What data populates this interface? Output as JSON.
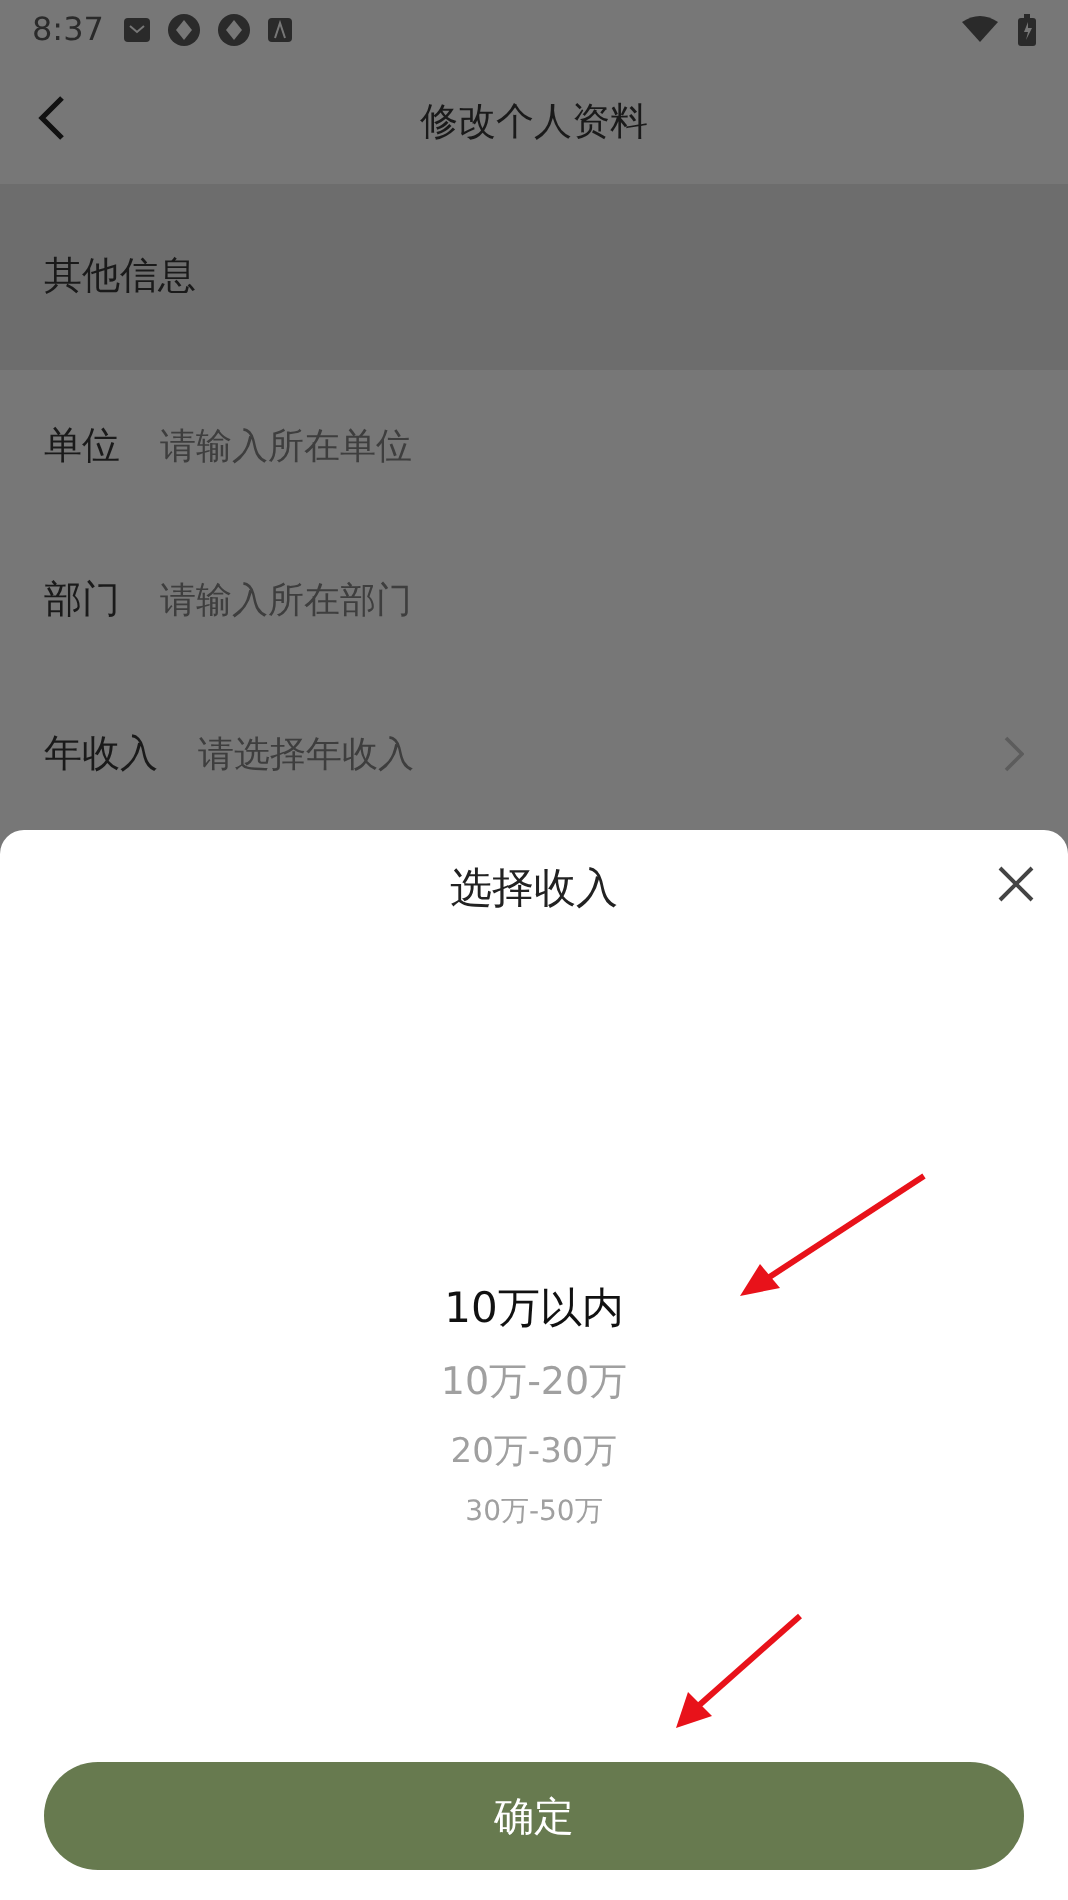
{
  "status_bar": {
    "time": "8:37"
  },
  "header": {
    "title": "修改个人资料"
  },
  "section": {
    "title": "其他信息"
  },
  "fields": [
    {
      "kind": "text",
      "label": "单位",
      "placeholder": "请输入所在单位"
    },
    {
      "kind": "text",
      "label": "部门",
      "placeholder": "请输入所在部门"
    },
    {
      "kind": "select",
      "label": "年收入",
      "placeholder": "请选择年收入"
    }
  ],
  "sheet": {
    "title": "选择收入",
    "options": [
      {
        "label": "10万以内",
        "selected": true
      },
      {
        "label": "10万-20万",
        "selected": false
      },
      {
        "label": "20万-30万",
        "selected": false
      },
      {
        "label": "30万-50万",
        "selected": false
      }
    ],
    "confirm": "确定"
  }
}
